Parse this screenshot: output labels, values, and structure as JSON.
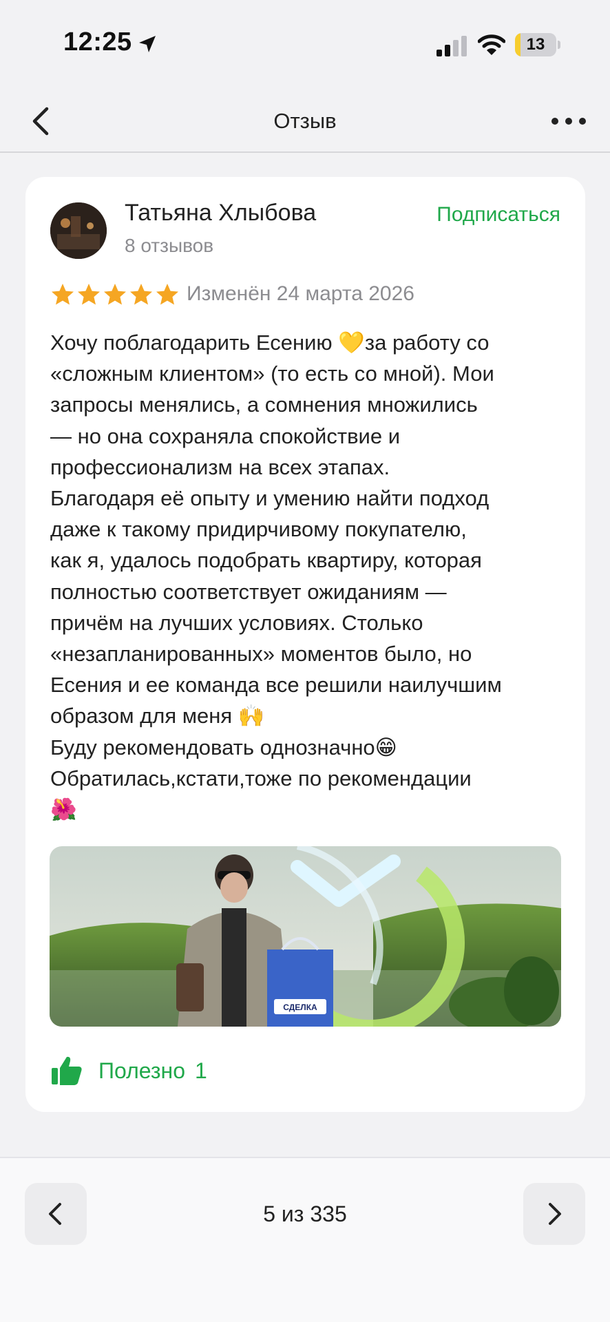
{
  "status_bar": {
    "time": "12:25",
    "battery_level": "13",
    "battery_fraction": 0.13
  },
  "nav": {
    "title": "Отзыв"
  },
  "review": {
    "author_name": "Татьяна Хлыбова",
    "author_reviews": "8 отзывов",
    "subscribe_label": "Подписаться",
    "rating": 5,
    "rating_max": 5,
    "date": "Изменён 24 марта 2026",
    "text": "Хочу поблагодарить Есению 💛за работу со\n«сложным клиентом» (то есть со мной). Мои\nзапросы менялись, а сомнения множились\n— но она сохраняла спокойствие и\nпрофессионализм на всех этапах.\nБлагодаря её опыту и умению найти подход\nдаже к такому придирчивому покупателю,\nкак я, удалось подобрать квартиру, которая\nполностью соответствует ожиданиям —\nпричём на лучших условиях. Столько\n«незапланированных» моментов было, но\nЕсения и ее команда все решили наилучшим\nобразом для меня 🙌\nБуду рекомендовать однозначно😁\nОбратилась,кстати,тоже по рекомендации\n🌺",
    "photo_bag_label": "СДЕЛКА",
    "useful_label": "Полезно",
    "useful_count": "1"
  },
  "pager": {
    "text": "5 из 335"
  },
  "colors": {
    "accent_green": "#20a84a",
    "star_orange": "#f5a623",
    "background": "#f2f2f4",
    "muted_text": "#8c8c90"
  },
  "icons": {
    "nav_back": "chevron-left-icon",
    "nav_more": "more-horizontal-icon",
    "useful": "thumbs-up-icon",
    "pager_prev": "chevron-left-icon",
    "pager_next": "chevron-right-icon"
  }
}
